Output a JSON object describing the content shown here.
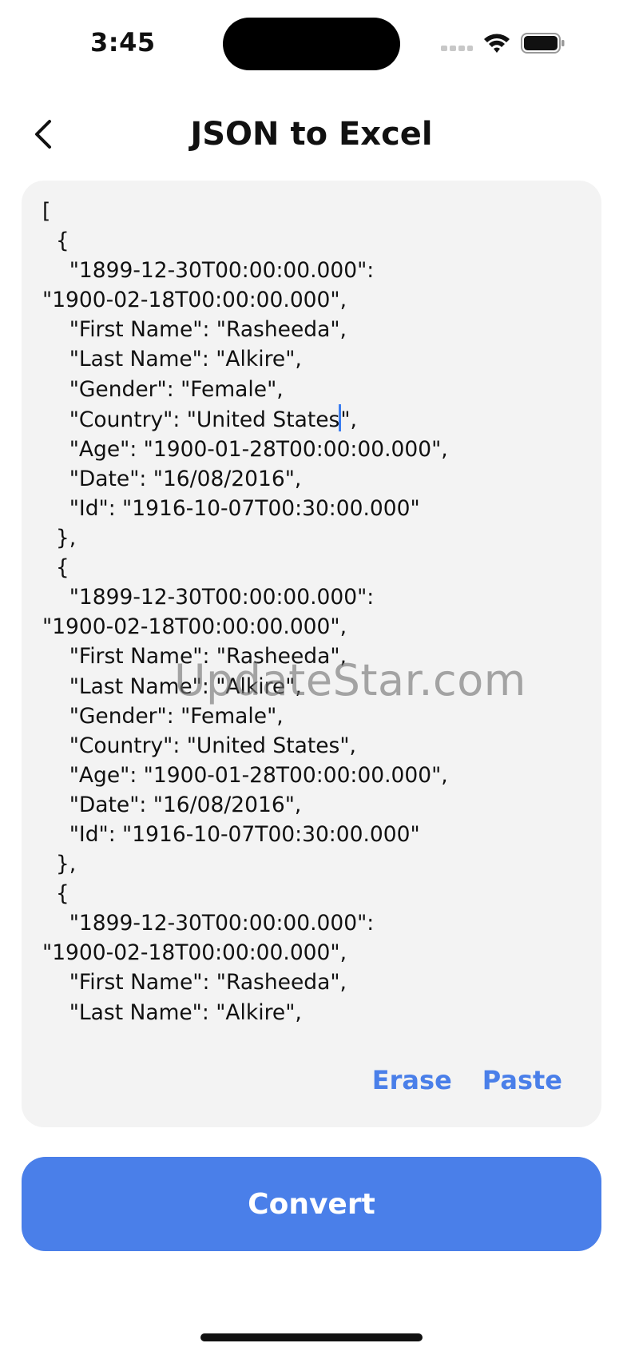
{
  "status_bar": {
    "time": "3:45",
    "icons": [
      "cellular-signal-icon",
      "wifi-icon",
      "battery-icon"
    ]
  },
  "header": {
    "back_icon": "chevron-left-icon",
    "title": "JSON to Excel"
  },
  "editor": {
    "content_before_caret": "[\n  {\n    \"1899-12-30T00:00:00.000\":\n\"1900-02-18T00:00:00.000\",\n    \"First Name\": \"Rasheeda\",\n    \"Last Name\": \"Alkire\",\n    \"Gender\": \"Female\",\n    \"Country\": \"United States",
    "content_after_caret": "\",\n    \"Age\": \"1900-01-28T00:00:00.000\",\n    \"Date\": \"16/08/2016\",\n    \"Id\": \"1916-10-07T00:30:00.000\"\n  },\n  {\n    \"1899-12-30T00:00:00.000\":\n\"1900-02-18T00:00:00.000\",\n    \"First Name\": \"Rasheeda\",\n    \"Last Name\": \"Alkire\",\n    \"Gender\": \"Female\",\n    \"Country\": \"United States\",\n    \"Age\": \"1900-01-28T00:00:00.000\",\n    \"Date\": \"16/08/2016\",\n    \"Id\": \"1916-10-07T00:30:00.000\"\n  },\n  {\n    \"1899-12-30T00:00:00.000\":\n\"1900-02-18T00:00:00.000\",\n    \"First Name\": \"Rasheeda\",\n    \"Last Name\": \"Alkire\",",
    "erase_label": "Erase",
    "paste_label": "Paste"
  },
  "watermark": "UpdateStar.com",
  "convert_label": "Convert",
  "colors": {
    "accent": "#4a7fe9",
    "editor_background": "#f3f3f3",
    "caret": "#3b7df0"
  }
}
